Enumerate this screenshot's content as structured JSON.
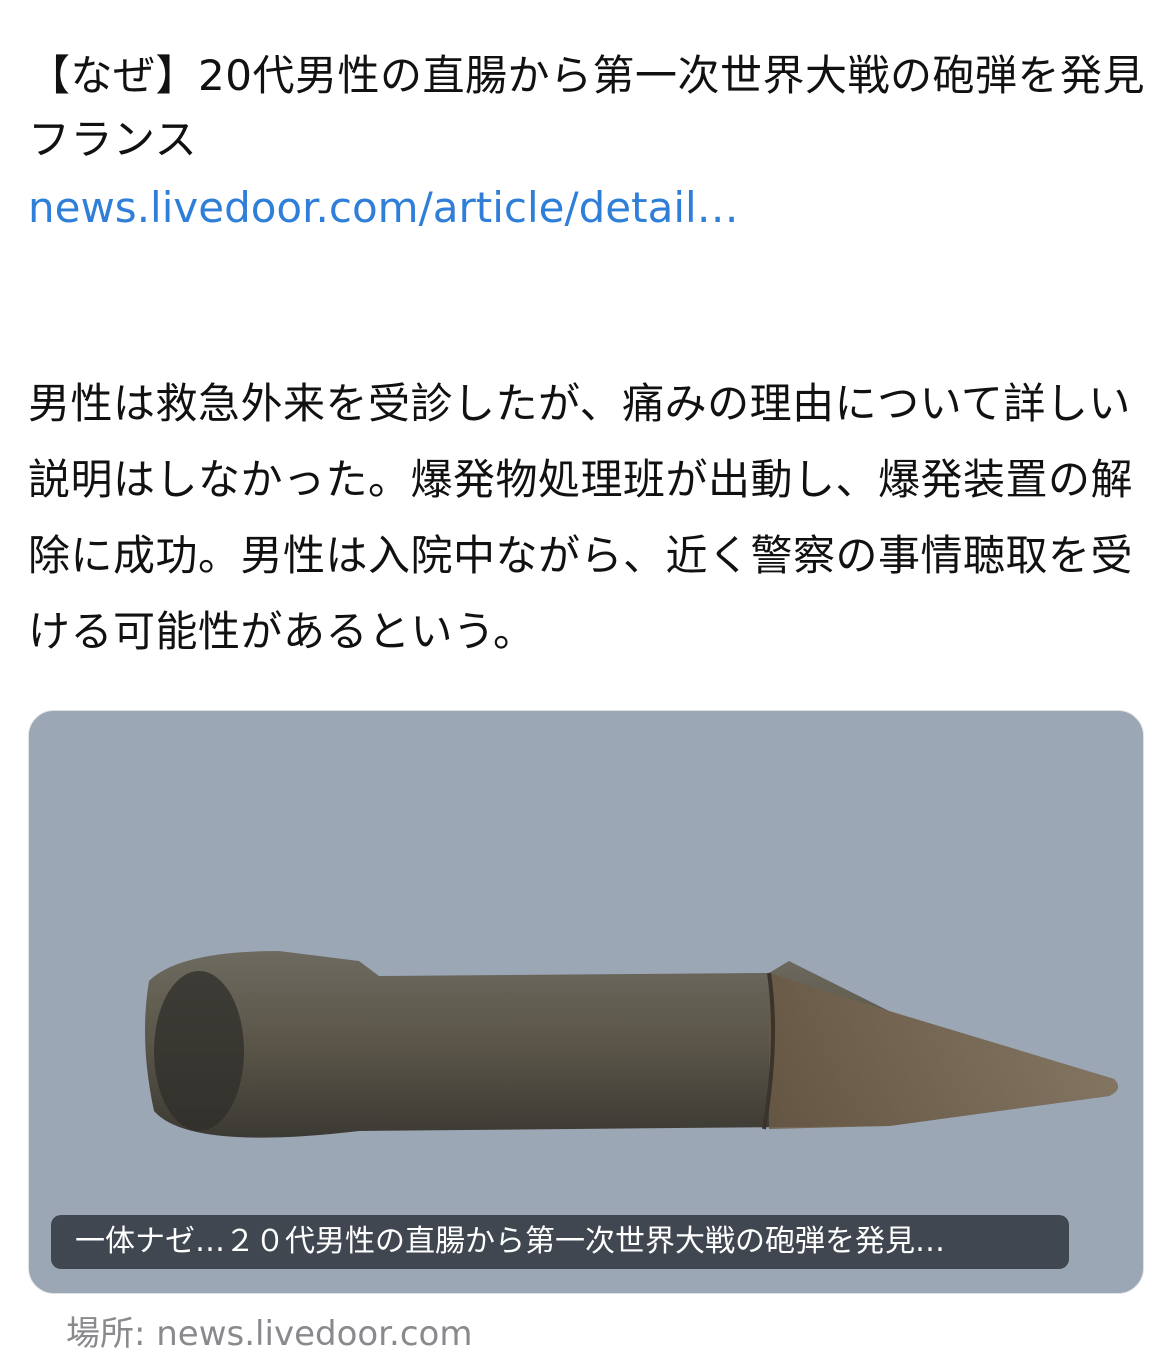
{
  "post": {
    "title": "【なぜ】20代男性の直腸から第一次世界大戦の砲弾を発見 フランス",
    "link_text": "news.livedoor.com/article/detail…",
    "body": "男性は救急外来を受診したが、痛みの理由について詳しい説明はしなかった。爆発物処理班が出動し、爆発装置の解除に成功。男性は入院中ながら、近く警察の事情聴取を受ける可能性があるという。"
  },
  "card": {
    "image_alt": "photo of corroded WWI artillery shell",
    "caption": "一体ナゼ…２０代男性の直腸から第一次世界大戦の砲弾を発見…",
    "source": "場所: news.livedoor.com"
  },
  "colors": {
    "link": "#2f7fd9",
    "text": "#111111",
    "source": "#8a8a8e"
  }
}
